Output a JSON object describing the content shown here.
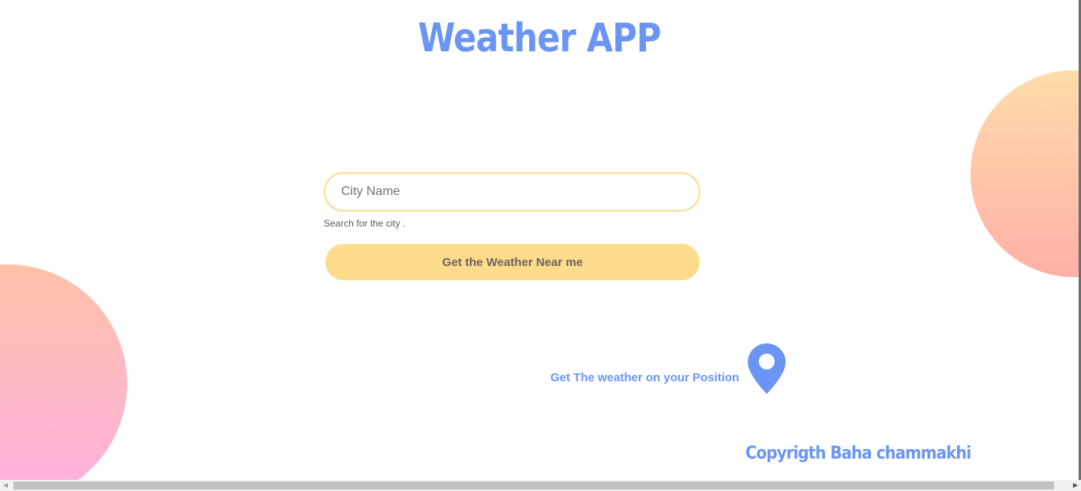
{
  "app": {
    "title": "Weather APP"
  },
  "search": {
    "placeholder": "City Name",
    "value": "",
    "help_text": "Search for the city ."
  },
  "actions": {
    "near_me_label": "Get the Weather Near me",
    "position_label": "Get The weather on your Position",
    "position_icon": "map-pin-icon"
  },
  "footer": {
    "copyright": "Copyrigth Baha chammakhi"
  },
  "colors": {
    "accent": "#6a95f5",
    "button": "#ffdb8c",
    "input_border": "#ffd98a",
    "circle_right_top": "#ffdcaa",
    "circle_right_bottom": "#ffb0a8",
    "circle_left_top": "#ffc1a8",
    "circle_left_bottom": "#ffb0e0"
  },
  "scrollbar": {
    "left_arrow": "◀",
    "right_arrow": "▶"
  }
}
